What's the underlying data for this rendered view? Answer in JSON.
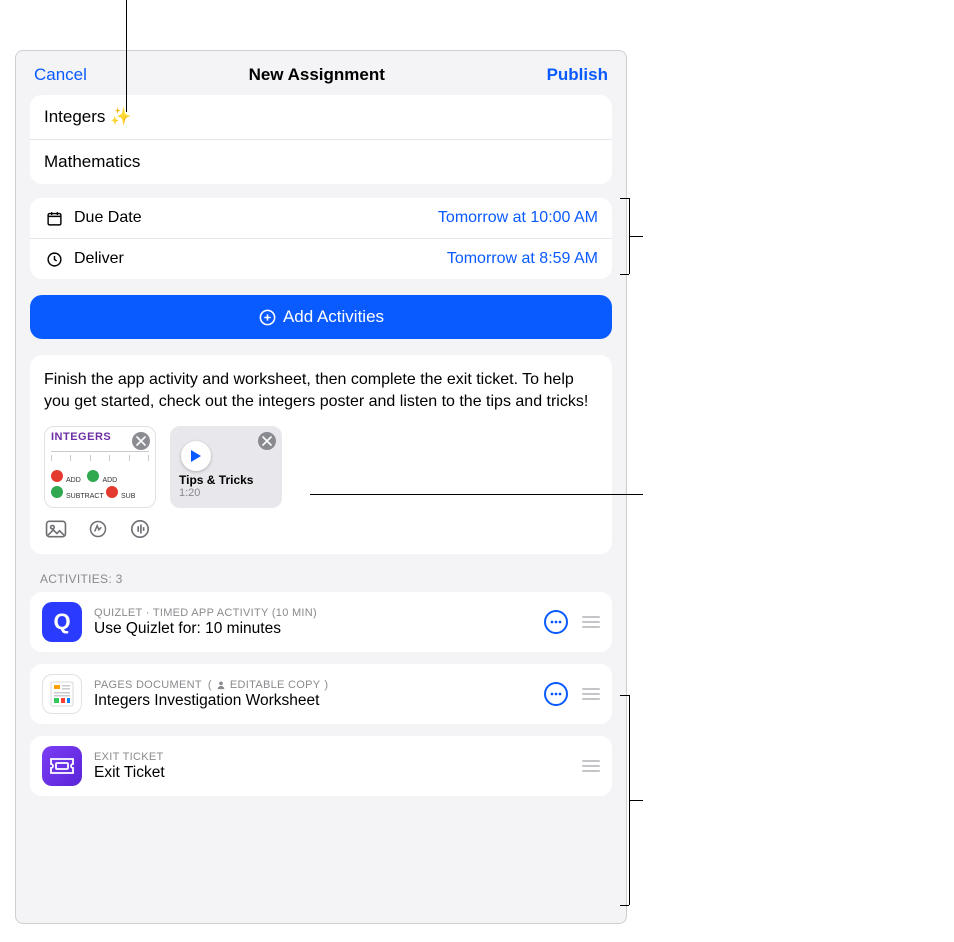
{
  "header": {
    "cancel": "Cancel",
    "title": "New Assignment",
    "publish": "Publish"
  },
  "title_field": "Integers ✨",
  "class_field": "Mathematics",
  "due": {
    "label": "Due Date",
    "value": "Tomorrow at 10:00 AM"
  },
  "deliver": {
    "label": "Deliver",
    "value": "Tomorrow at 8:59 AM"
  },
  "add_activities": "Add Activities",
  "instructions": "Finish the app activity and worksheet, then complete the exit ticket. To help you get started, check out the integers poster and listen to the tips and tricks!",
  "attachments": {
    "poster_title": "INTEGERS",
    "audio_title": "Tips & Tricks",
    "audio_duration": "1:20"
  },
  "activities_label": "ACTIVITIES: 3",
  "activities": [
    {
      "meta1": "QUIZLET · TIMED APP ACTIVITY (10 MIN)",
      "meta_badge": "",
      "title": "Use Quizlet for: 10 minutes",
      "has_more": true
    },
    {
      "meta1": "PAGES DOCUMENT",
      "meta_badge": "EDITABLE COPY",
      "title": "Integers Investigation Worksheet",
      "has_more": true
    },
    {
      "meta1": "EXIT TICKET",
      "meta_badge": "",
      "title": "Exit Ticket",
      "has_more": false
    }
  ]
}
